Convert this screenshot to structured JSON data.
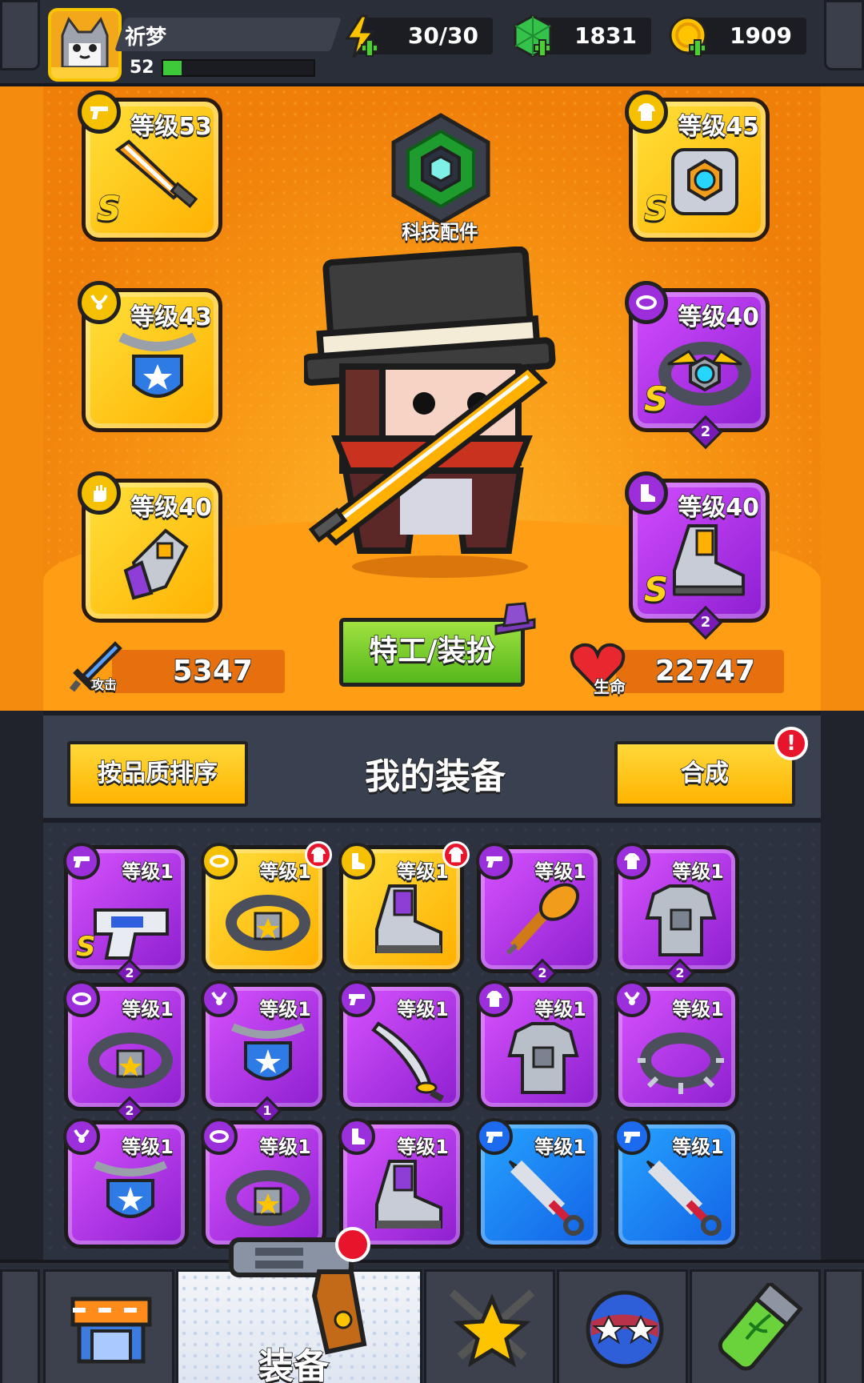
{
  "header": {
    "player_name": "祈梦",
    "player_level": "52",
    "xp_fraction": 0.12,
    "energy": "30/30",
    "gems": "1831",
    "coins": "1909"
  },
  "hero": {
    "tech_label": "科技配件",
    "agent_button": "特工/装扮",
    "attack_label": "攻击",
    "attack_value": "5347",
    "hp_label": "生命",
    "hp_value": "22747",
    "equipped": [
      {
        "slot": "weapon",
        "icon": "sword-icon",
        "level": "等级53",
        "rank": "S",
        "rarity": "gold"
      },
      {
        "slot": "armor",
        "icon": "armor-icon",
        "level": "等级45",
        "rank": "S",
        "rarity": "gold"
      },
      {
        "slot": "necklace",
        "icon": "shield-necklace-icon",
        "level": "等级43",
        "rank": "",
        "rarity": "gold"
      },
      {
        "slot": "belt",
        "icon": "belt-icon",
        "level": "等级40",
        "rank": "S",
        "rarity": "purple",
        "stars": "2"
      },
      {
        "slot": "gloves",
        "icon": "glove-icon",
        "level": "等级40",
        "rank": "",
        "rarity": "gold"
      },
      {
        "slot": "boots",
        "icon": "boot-icon",
        "level": "等级40",
        "rank": "S",
        "rarity": "purple",
        "stars": "2"
      }
    ]
  },
  "panel": {
    "sort_button": "按品质排序",
    "title": "我的装备",
    "merge_button": "合成",
    "merge_alert": "!"
  },
  "inventory": [
    {
      "icon": "gun-icon",
      "level": "等级1",
      "rarity": "purple",
      "rank": "S",
      "stars": "2",
      "new": false
    },
    {
      "icon": "belt-icon",
      "level": "等级1",
      "rarity": "gold",
      "rank": "",
      "stars": "",
      "new": true
    },
    {
      "icon": "boot-icon",
      "level": "等级1",
      "rarity": "gold",
      "rank": "",
      "stars": "",
      "new": true
    },
    {
      "icon": "mace-icon",
      "level": "等级1",
      "rarity": "purple",
      "rank": "",
      "stars": "2",
      "new": false
    },
    {
      "icon": "armor-icon",
      "level": "等级1",
      "rarity": "purple",
      "rank": "",
      "stars": "2",
      "new": false
    },
    {
      "icon": "belt-icon",
      "level": "等级1",
      "rarity": "purple",
      "rank": "",
      "stars": "2",
      "new": false
    },
    {
      "icon": "shield-necklace-icon",
      "level": "等级1",
      "rarity": "purple",
      "rank": "",
      "stars": "1",
      "new": false
    },
    {
      "icon": "sword-icon",
      "level": "等级1",
      "rarity": "purple",
      "rank": "",
      "stars": "",
      "new": false
    },
    {
      "icon": "armor-icon",
      "level": "等级1",
      "rarity": "purple",
      "rank": "",
      "stars": "",
      "new": false
    },
    {
      "icon": "spiked-collar-icon",
      "level": "等级1",
      "rarity": "purple",
      "rank": "",
      "stars": "",
      "new": false
    },
    {
      "icon": "shield-necklace-icon",
      "level": "等级1",
      "rarity": "purple",
      "rank": "",
      "stars": "",
      "new": false
    },
    {
      "icon": "belt-icon",
      "level": "等级1",
      "rarity": "purple",
      "rank": "",
      "stars": "",
      "new": false
    },
    {
      "icon": "boot-icon",
      "level": "等级1",
      "rarity": "purple",
      "rank": "",
      "stars": "",
      "new": false
    },
    {
      "icon": "kunai-icon",
      "level": "等级1",
      "rarity": "blue",
      "rank": "",
      "stars": "",
      "new": false
    },
    {
      "icon": "kunai-icon",
      "level": "等级1",
      "rarity": "blue",
      "rank": "",
      "stars": "",
      "new": false
    }
  ],
  "nav": {
    "items": [
      {
        "icon": "shop-icon"
      },
      {
        "icon": "revolver-icon",
        "label": "装备",
        "active": true
      },
      {
        "icon": "star-swords-icon"
      },
      {
        "icon": "planet-icon"
      },
      {
        "icon": "dna-capsule-icon"
      }
    ]
  },
  "colors": {
    "gold": "#ffc400",
    "purple": "#b235f0",
    "blue": "#1f80ff",
    "hero_bg": "#f48b0e",
    "green_button": "#7ccf2d"
  }
}
